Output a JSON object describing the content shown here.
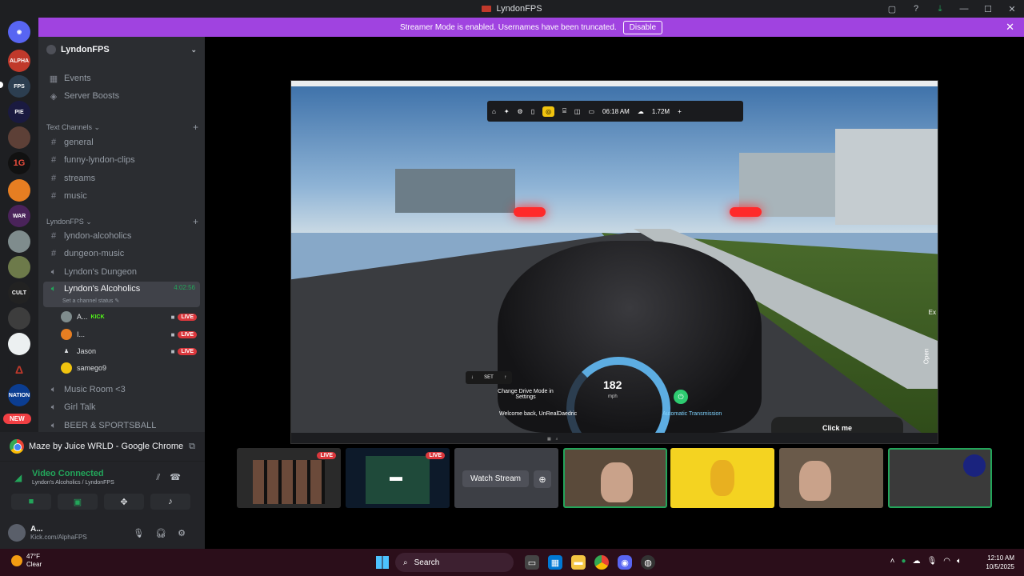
{
  "window": {
    "title": "LyndonFPS",
    "controls": [
      "▢",
      "?",
      "⤓",
      "—",
      "☐",
      "✕"
    ]
  },
  "banner": {
    "message": "Streamer Mode is enabled. Usernames have been truncated.",
    "button": "Disable",
    "close": "✕"
  },
  "guilds": {
    "new_badge": "NEW",
    "labels": [
      "ALPHA",
      "FPS",
      "PIE",
      "",
      "1G",
      "",
      "WAR",
      "",
      "",
      "CULT",
      "",
      "",
      "Δ",
      "NATION"
    ]
  },
  "server": {
    "name": "LyndonFPS",
    "chevron": "⌄"
  },
  "nav": {
    "events": "Events",
    "boosts": "Server Boosts"
  },
  "categories": {
    "text": "Text Channels ⌄",
    "lyndon": "LyndonFPS ⌄",
    "plus": "+"
  },
  "text_channels": [
    "general",
    "funny-lyndon-clips",
    "streams",
    "music"
  ],
  "lyndon_channels": [
    "lyndon-alcoholics",
    "dungeon-music"
  ],
  "voice_channels": {
    "dungeon": "Lyndon's Dungeon",
    "active": "Lyndon's Alcoholics",
    "active_timer": "4:02:56",
    "status": "Set a channel status ✎",
    "music_room": "Music Room <3",
    "girl_talk": "Girl Talk",
    "beer": "BEER & SPORTSBALL"
  },
  "voice_users": [
    {
      "name": "A...",
      "tag": "KICK",
      "live": "LIVE"
    },
    {
      "name": "I...",
      "tag": "",
      "live": "LIVE"
    },
    {
      "name": "Jason",
      "tag": "",
      "live": "LIVE"
    },
    {
      "name": "samego9",
      "tag": "",
      "live": ""
    }
  ],
  "activity": {
    "title": "Maze by Juice WRLD - Google Chrome"
  },
  "voice_panel": {
    "status": "Video Connected",
    "location": "Lyndon's Alcoholics / LyndonFPS"
  },
  "user": {
    "name": "A...",
    "status": "Kick.com/AlphaFPS"
  },
  "game": {
    "time": "06:18 AM",
    "money": "1.72M",
    "speed": "182",
    "unit": "mph",
    "drive_mode": "Change Drive Mode in Settings",
    "welcome": "Welcome back, UnRealDaedric",
    "transmission": "Automatic Transmission",
    "click_me": "Click me",
    "set_label": "SET",
    "side_open": "Open",
    "side_ex": "Ex"
  },
  "thumbs": {
    "live": "LIVE",
    "watch": "Watch Stream",
    "watch_plus": "⊕"
  },
  "taskbar": {
    "temp": "47°F",
    "condition": "Clear",
    "search": "Search",
    "time": "12:10 AM",
    "date": "10/5/2025"
  },
  "colors": {
    "accent": "#a043e0",
    "live": "#da373c",
    "online": "#23a55a"
  }
}
